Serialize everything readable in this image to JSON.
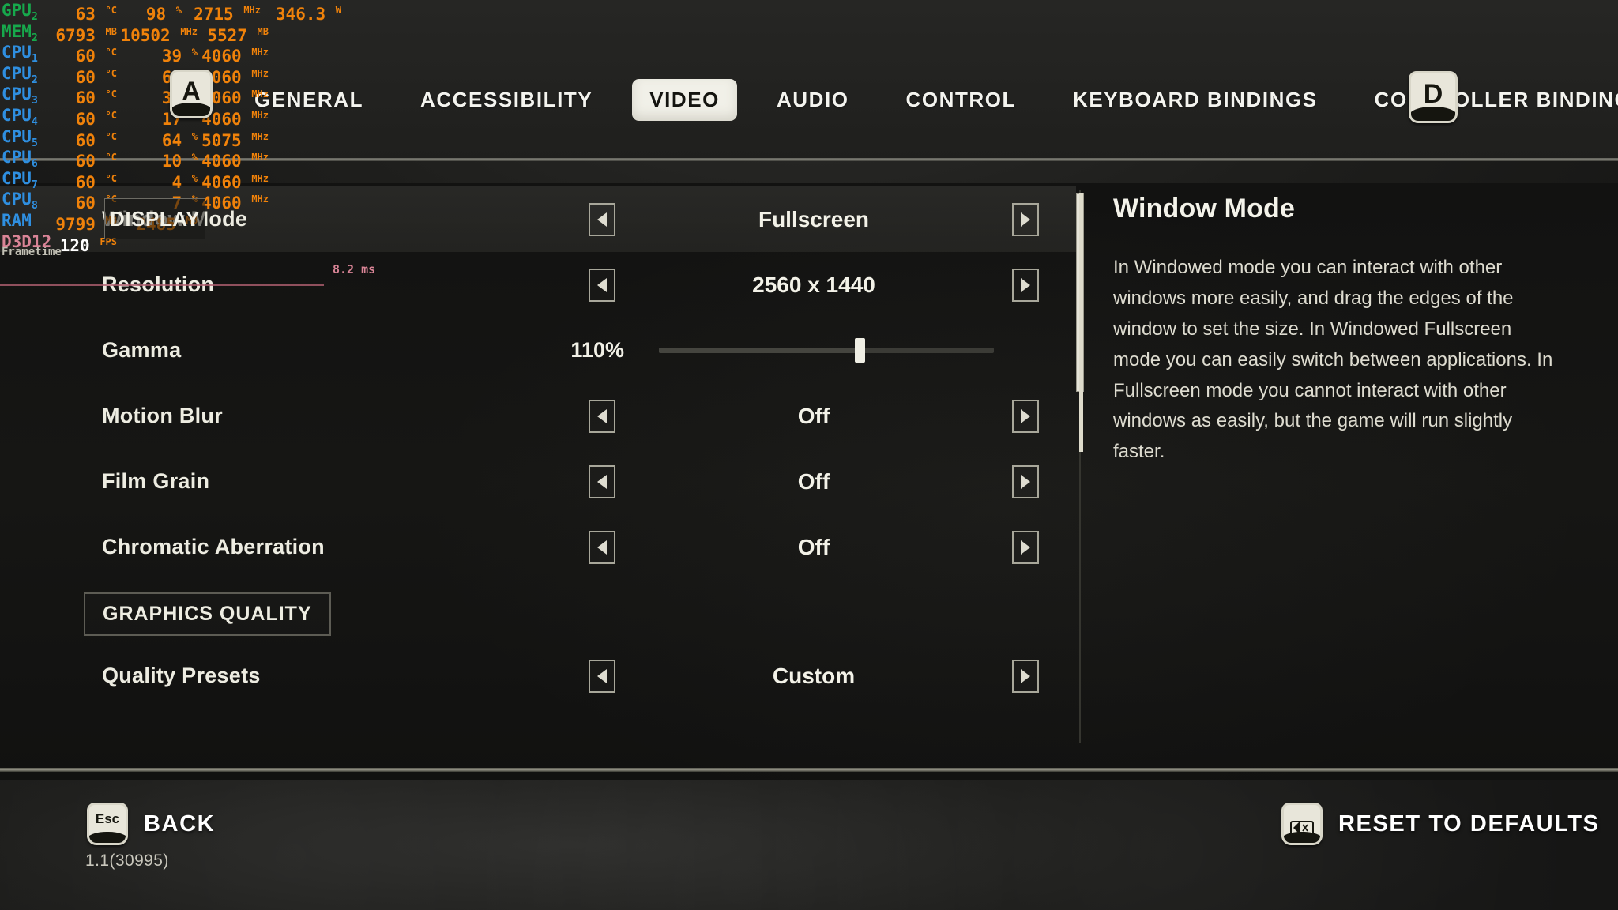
{
  "header": {
    "tabs": [
      {
        "label": "GENERAL",
        "active": false
      },
      {
        "label": "ACCESSIBILITY",
        "active": false
      },
      {
        "label": "VIDEO",
        "active": true
      },
      {
        "label": "AUDIO",
        "active": false
      },
      {
        "label": "CONTROL",
        "active": false
      },
      {
        "label": "KEYBOARD BINDINGS",
        "active": false
      },
      {
        "label": "CONTROLLER BINDINGS",
        "active": false
      }
    ],
    "next_tab_key": "D",
    "prev_tab_key": "A"
  },
  "settings": {
    "rows": [
      {
        "label": "Window Mode",
        "value": "Fullscreen",
        "type": "stepper",
        "selected": true
      },
      {
        "label": "Resolution",
        "value": "2560 x 1440",
        "type": "stepper",
        "selected": false
      },
      {
        "label": "Gamma",
        "value": "110%",
        "type": "slider",
        "selected": false,
        "percent": 60
      },
      {
        "label": "Motion Blur",
        "value": "Off",
        "type": "stepper",
        "selected": false
      },
      {
        "label": "Film Grain",
        "value": "Off",
        "type": "stepper",
        "selected": false
      },
      {
        "label": "Chromatic Aberration",
        "value": "Off",
        "type": "stepper",
        "selected": false
      }
    ],
    "section_header": "GRAPHICS QUALITY",
    "rows_after_section": [
      {
        "label": "Quality Presets",
        "value": "Custom",
        "type": "stepper",
        "selected": false
      }
    ]
  },
  "description": {
    "title": "Window Mode",
    "body": "In Windowed mode you can interact with other windows more easily, and drag the edges of the window to set the size. In Windowed Fullscreen mode you can easily switch between applications. In Fullscreen mode you cannot interact with other windows as easily, but the game will run slightly faster."
  },
  "footer": {
    "back_label": "BACK",
    "back_key": "Esc",
    "reset_label": "RESET TO DEFAULTS",
    "reset_key": "backspace-icon",
    "version": "1.1(30995)"
  },
  "hint": {
    "display_label": "DISPLAY"
  },
  "osd": {
    "rows": [
      {
        "name": "GPU",
        "sub": "2",
        "cls": "c-gpu",
        "cells": [
          {
            "v": "63",
            "u": "°C"
          },
          {
            "v": "98",
            "u": "%"
          },
          {
            "v": "2715",
            "u": "MHz"
          },
          {
            "v": "346.3",
            "u": "W"
          }
        ]
      },
      {
        "name": "MEM",
        "sub": "2",
        "cls": "c-mem",
        "cells": [
          {
            "v": "6793",
            "u": "MB"
          },
          {
            "v": "10502",
            "u": "MHz"
          },
          {
            "v": "5527",
            "u": "MB"
          }
        ]
      },
      {
        "name": "CPU",
        "sub": "1",
        "cls": "c-cpu",
        "cells": [
          {
            "v": "60",
            "u": "°C"
          },
          {
            "v": "39",
            "u": "%"
          },
          {
            "v": "4060",
            "u": "MHz"
          }
        ]
      },
      {
        "name": "CPU",
        "sub": "2",
        "cls": "c-cpu",
        "cells": [
          {
            "v": "60",
            "u": "°C"
          },
          {
            "v": "68",
            "u": "%"
          },
          {
            "v": "4060",
            "u": "MHz"
          }
        ]
      },
      {
        "name": "CPU",
        "sub": "3",
        "cls": "c-cpu",
        "cells": [
          {
            "v": "60",
            "u": "°C"
          },
          {
            "v": "36",
            "u": "%"
          },
          {
            "v": "4060",
            "u": "MHz"
          }
        ]
      },
      {
        "name": "CPU",
        "sub": "4",
        "cls": "c-cpu",
        "cells": [
          {
            "v": "60",
            "u": "°C"
          },
          {
            "v": "17",
            "u": "%"
          },
          {
            "v": "4060",
            "u": "MHz"
          }
        ]
      },
      {
        "name": "CPU",
        "sub": "5",
        "cls": "c-cpu",
        "cells": [
          {
            "v": "60",
            "u": "°C"
          },
          {
            "v": "64",
            "u": "%"
          },
          {
            "v": "5075",
            "u": "MHz"
          }
        ]
      },
      {
        "name": "CPU",
        "sub": "6",
        "cls": "c-cpu",
        "cells": [
          {
            "v": "60",
            "u": "°C"
          },
          {
            "v": "10",
            "u": "%"
          },
          {
            "v": "4060",
            "u": "MHz"
          }
        ]
      },
      {
        "name": "CPU",
        "sub": "7",
        "cls": "c-cpu",
        "cells": [
          {
            "v": "60",
            "u": "°C"
          },
          {
            "v": "4",
            "u": "%"
          },
          {
            "v": "4060",
            "u": "MHz"
          }
        ]
      },
      {
        "name": "CPU",
        "sub": "8",
        "cls": "c-cpu",
        "cells": [
          {
            "v": "60",
            "u": "°C"
          },
          {
            "v": "7",
            "u": "%"
          },
          {
            "v": "4060",
            "u": "MHz"
          }
        ]
      },
      {
        "name": "RAM",
        "sub": "",
        "cls": "c-ram",
        "cells": [
          {
            "v": "9799",
            "u": "MB"
          },
          {
            "v": "2485",
            "u": "MB"
          }
        ]
      },
      {
        "name": "D3D12",
        "sub": "",
        "cls": "c-api",
        "cells": [
          {
            "v": "120",
            "u": "FPS",
            "white": true
          }
        ]
      }
    ],
    "frametime_label": "Frametime",
    "frametime_value": "8.2 ms"
  }
}
